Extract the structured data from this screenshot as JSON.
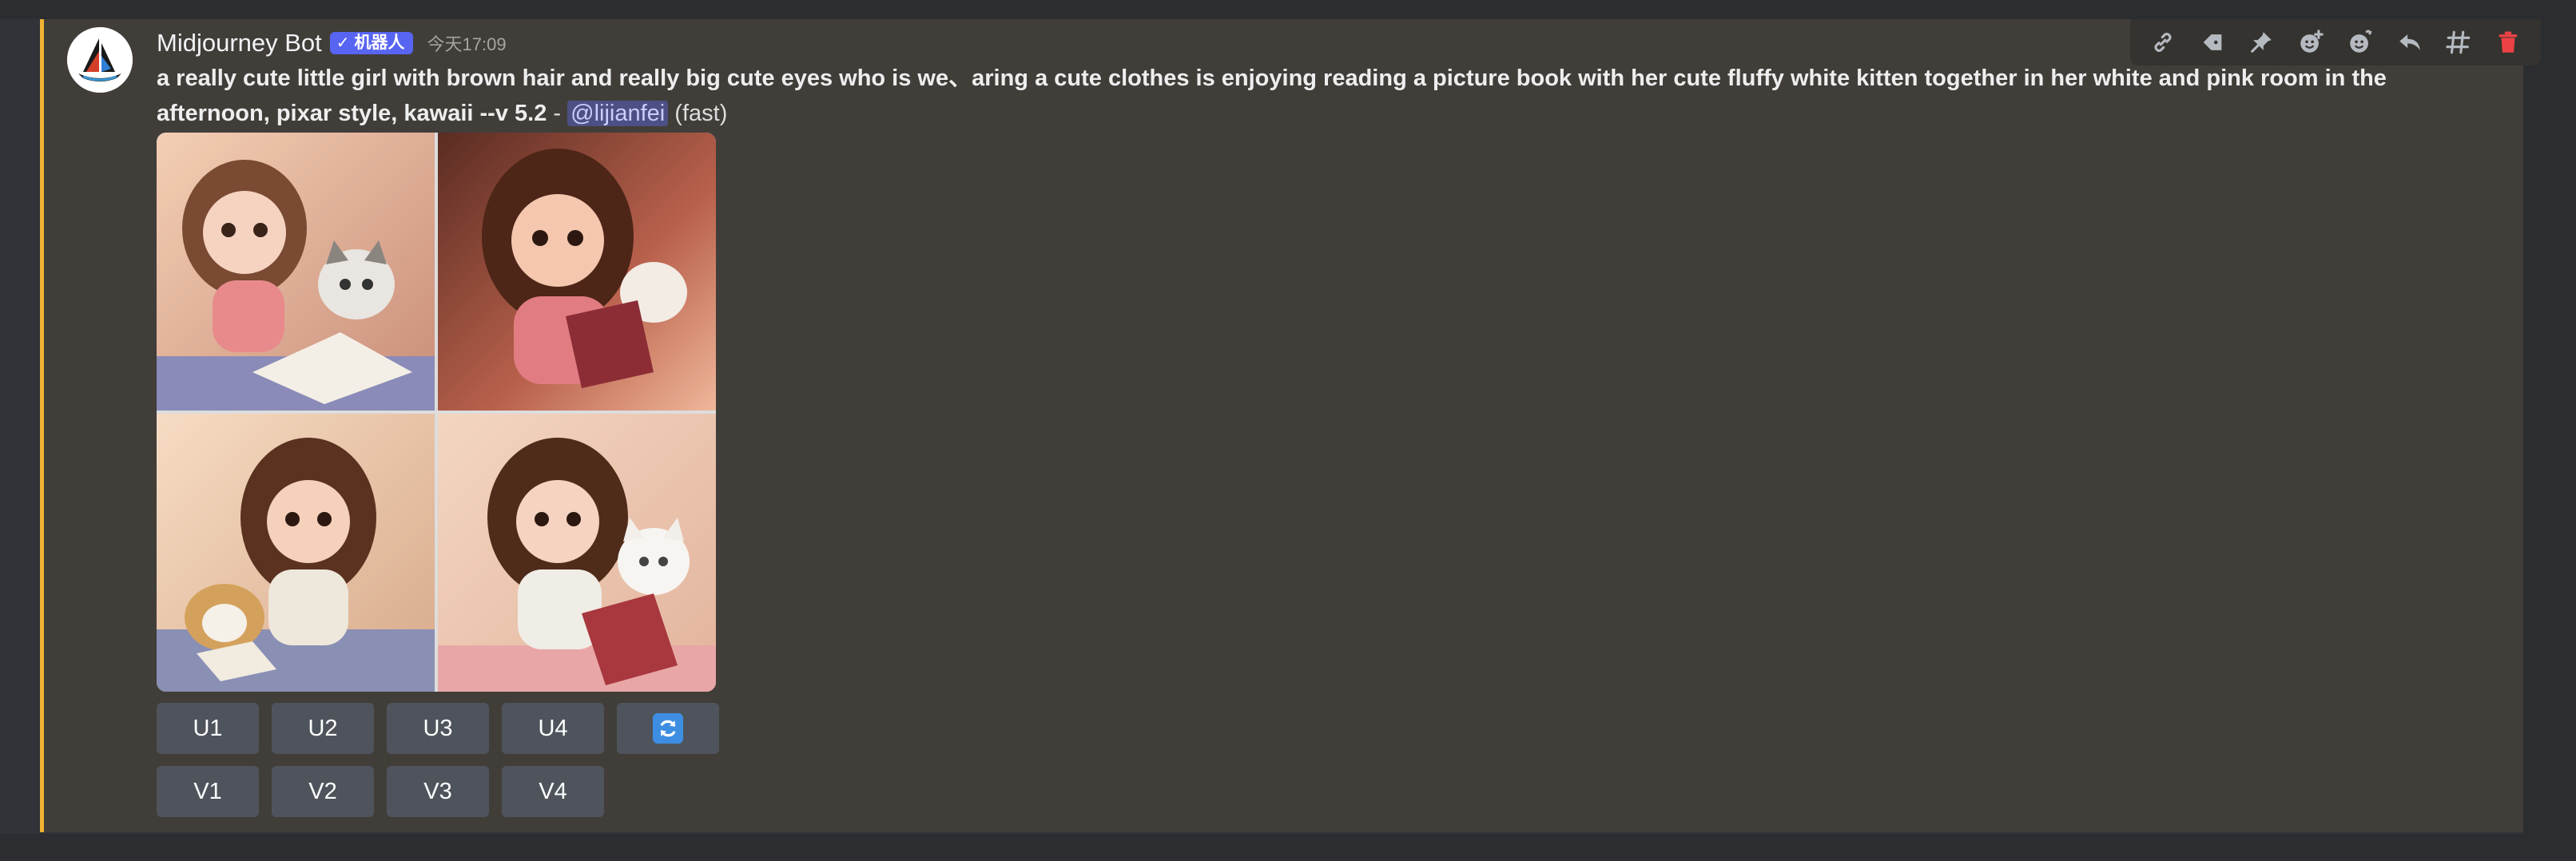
{
  "message": {
    "author": "Midjourney Bot",
    "badge": {
      "check": "✓",
      "label": "机器人"
    },
    "timestamp": "今天17:09",
    "prompt": "a really cute little girl with brown hair and really big cute eyes who is we、aring a cute clothes is enjoying reading a picture book with her cute fluffy white kitten together in her white and pink room in the afternoon, pixar style, kawaii --v 5.2",
    "separator": " - ",
    "mention": "@lijianfei",
    "mode": "(fast)"
  },
  "buttons": {
    "upscale": [
      "U1",
      "U2",
      "U3",
      "U4"
    ],
    "variation": [
      "V1",
      "V2",
      "V3",
      "V4"
    ]
  },
  "icons": {
    "avatar": "midjourney-sailboat-logo",
    "reroll": "refresh-icon",
    "toolbar": [
      "link-icon",
      "tag-icon",
      "pin-icon",
      "add-reaction-icon",
      "super-reaction-icon",
      "reply-icon",
      "create-thread-icon",
      "delete-icon"
    ]
  },
  "colors": {
    "background": "#313338",
    "message_highlight": "#413e3a",
    "highlight_bar": "#f0b232",
    "bot_badge": "#5865f2",
    "button": "#4f545c",
    "mention_bg": "#4c5084",
    "delete": "#ed4245"
  }
}
